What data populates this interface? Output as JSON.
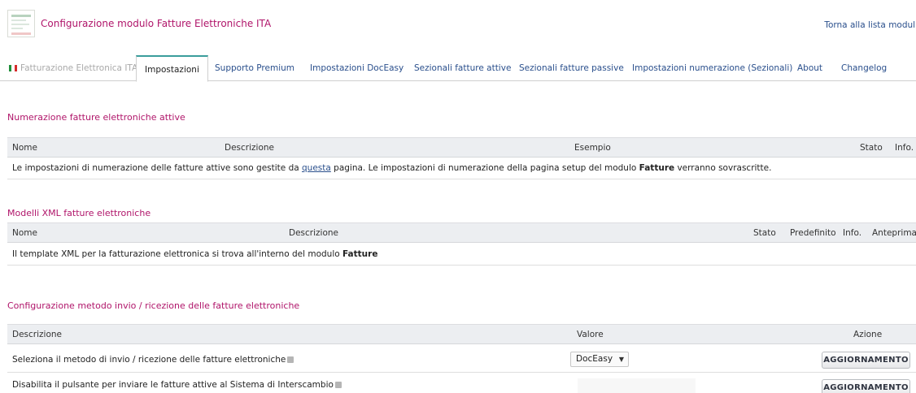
{
  "header": {
    "title": "Configurazione modulo Fatture Elettroniche ITA",
    "back_link": "Torna alla lista moduli"
  },
  "tabs": [
    {
      "label": "Fatturazione Elettronica ITA",
      "state": "disabled",
      "icon": "italy-flag-icon"
    },
    {
      "label": "Impostazioni",
      "state": "active"
    },
    {
      "label": "Supporto Premium"
    },
    {
      "label": "Impostazioni DocEasy"
    },
    {
      "label": "Sezionali fatture attive"
    },
    {
      "label": "Sezionali fatture passive"
    },
    {
      "label": "Impostazioni numerazione (Sezionali)"
    },
    {
      "label": "About"
    },
    {
      "label": "Changelog"
    }
  ],
  "section1": {
    "title": "Numerazione fatture elettroniche attive",
    "columns": [
      "Nome",
      "Descrizione",
      "Esempio",
      "Stato",
      "Info."
    ],
    "row": {
      "text_a": "Le impostazioni di numerazione delle fatture attive sono gestite da ",
      "link": "questa",
      "text_b": " pagina. Le impostazioni di numerazione della pagina setup del modulo ",
      "bold": "Fatture",
      "text_c": " verranno sovrascritte."
    }
  },
  "section2": {
    "title": "Modelli XML fatture elettroniche",
    "columns": [
      "Nome",
      "Descrizione",
      "Stato",
      "Predefinito",
      "Info.",
      "Anteprima"
    ],
    "row": {
      "text_a": "Il template XML per la fatturazione elettronica si trova all'interno del modulo ",
      "bold": "Fatture"
    }
  },
  "section3": {
    "title": "Configurazione metodo invio / ricezione delle fatture elettroniche",
    "columns": [
      "Descrizione",
      "Valore",
      "Azione"
    ],
    "rows": [
      {
        "label": "Seleziona il metodo di invio / ricezione delle fatture elettroniche",
        "value": "DocEasy",
        "button": "AGGIORNAMENTO"
      },
      {
        "label": "Disabilita il pulsante per inviare le fatture attive al Sistema di Interscambio",
        "value": "",
        "button": "AGGIORNAMENTO"
      }
    ]
  },
  "colors": {
    "accent": "#b0156a",
    "link": "#2a4f8c",
    "active_tab_border": "#3a9d9b",
    "table_header_bg": "#eceef1"
  }
}
